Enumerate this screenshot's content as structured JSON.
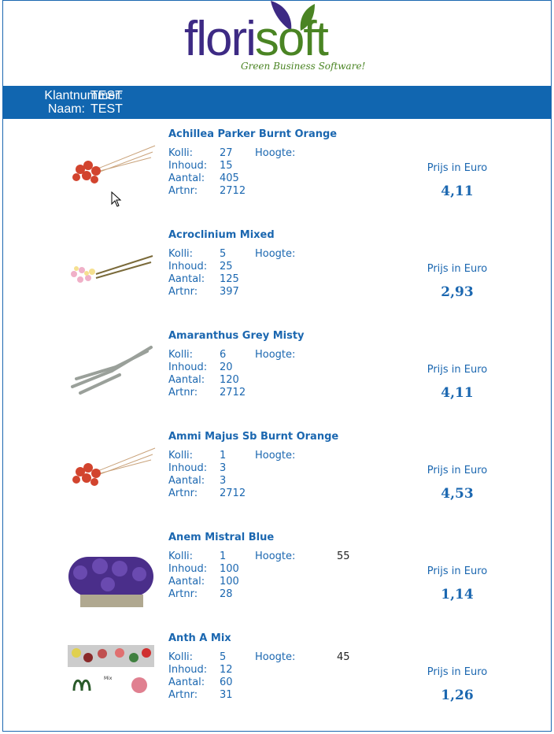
{
  "brand": {
    "name_part1": "flori",
    "name_part2": "soft",
    "tagline": "Green Business Software!",
    "colors": {
      "purple": "#3d2a84",
      "green": "#4a8423",
      "header_bar": "#1166b0",
      "text": "#1b67b0"
    }
  },
  "customer": {
    "number_label": "Klantnummer:",
    "number": "TEST",
    "name_label": "Naam:",
    "name": "TEST"
  },
  "labels": {
    "kolli": "Kolli:",
    "inhoud": "Inhoud:",
    "aantal": "Aantal:",
    "artnr": "Artnr:",
    "hoogte": "Hoogte:",
    "price": "Prijs in Euro"
  },
  "products": [
    {
      "name": "Achillea Parker Burnt Orange",
      "kolli": "27",
      "inhoud": "15",
      "aantal": "405",
      "artnr": "2712",
      "hoogte": "",
      "price": "4,11",
      "image": "red-dried-flowers"
    },
    {
      "name": "Acroclinium Mixed",
      "kolli": "5",
      "inhoud": "25",
      "aantal": "125",
      "artnr": "397",
      "hoogte": "",
      "price": "2,93",
      "image": "pink-dried-flowers"
    },
    {
      "name": "Amaranthus Grey Misty",
      "kolli": "6",
      "inhoud": "20",
      "aantal": "120",
      "artnr": "2712",
      "hoogte": "",
      "price": "4,11",
      "image": "grey-dried-grass"
    },
    {
      "name": "Ammi Majus Sb Burnt Orange",
      "kolli": "1",
      "inhoud": "3",
      "aantal": "3",
      "artnr": "2712",
      "hoogte": "",
      "price": "4,53",
      "image": "red-dried-flowers"
    },
    {
      "name": "Anem Mistral Blue",
      "kolli": "1",
      "inhoud": "100",
      "aantal": "100",
      "artnr": "28",
      "hoogte": "55",
      "price": "1,14",
      "image": "blue-anemone-bouquet"
    },
    {
      "name": "Anth A Mix",
      "kolli": "5",
      "inhoud": "12",
      "aantal": "60",
      "artnr": "31",
      "hoogte": "45",
      "price": "1,26",
      "image": "anthurium-mix-box"
    }
  ]
}
